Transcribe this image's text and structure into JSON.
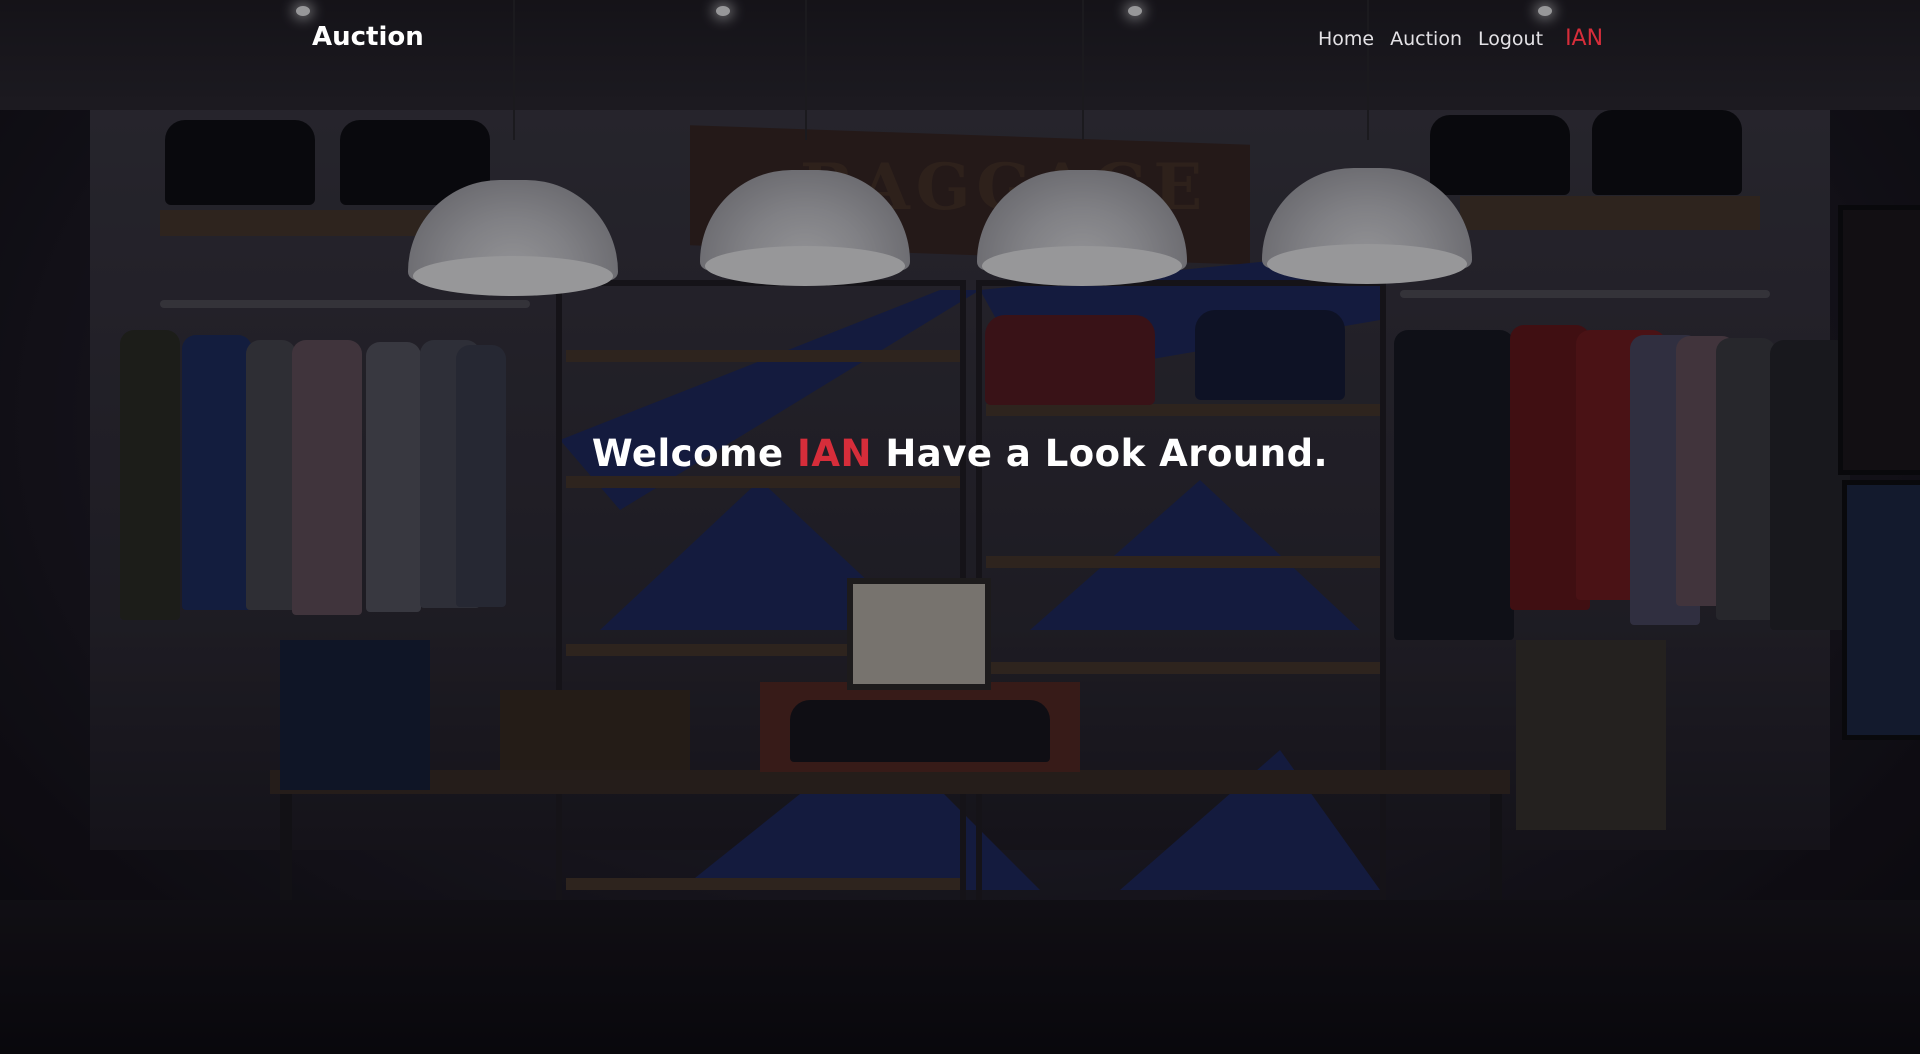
{
  "navbar": {
    "brand": "Auction",
    "links": [
      {
        "label": "Home"
      },
      {
        "label": "Auction"
      },
      {
        "label": "Logout"
      }
    ],
    "user": "IAN"
  },
  "hero": {
    "prefix": "Welcome",
    "user": "IAN",
    "suffix": "Have a Look Around."
  },
  "background": {
    "sign_text": "BAGGAGE"
  },
  "colors": {
    "accent": "#d62d3a",
    "text": "#ffffff",
    "nav_text": "#e4e2e6"
  }
}
